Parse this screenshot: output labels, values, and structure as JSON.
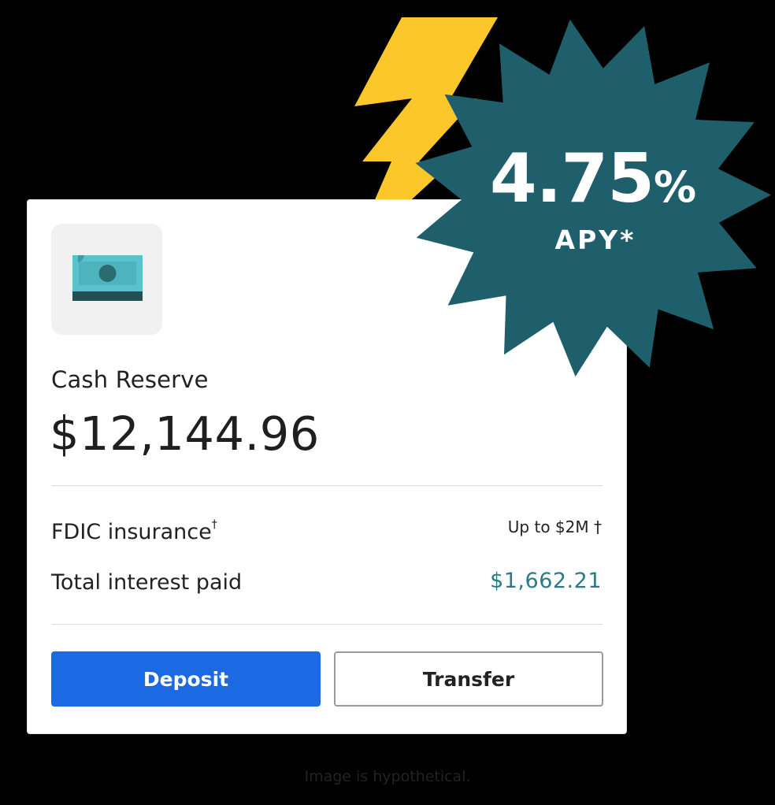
{
  "card": {
    "account_name": "Cash Reserve",
    "balance": "$12,144.96",
    "icon": "cash-bill-icon",
    "rows": [
      {
        "label": "FDIC insurance",
        "label_sup": "†",
        "value": "Up to $2M †"
      },
      {
        "label": "Total interest paid",
        "value": "$1,662.21",
        "value_color": "#2b7a86"
      }
    ],
    "buttons": {
      "deposit_label": "Deposit",
      "transfer_label": "Transfer"
    }
  },
  "badge": {
    "rate": "4.75",
    "rate_unit": "%",
    "label": "APY*",
    "color": "#1f5f6b",
    "lightning_color": "#fcc72a"
  },
  "disclaimer": "Image is hypothetical.",
  "colors": {
    "primary_button": "#1b6ae4",
    "accent_teal": "#2b7a86",
    "background": "#000000",
    "card_background": "#ffffff"
  }
}
